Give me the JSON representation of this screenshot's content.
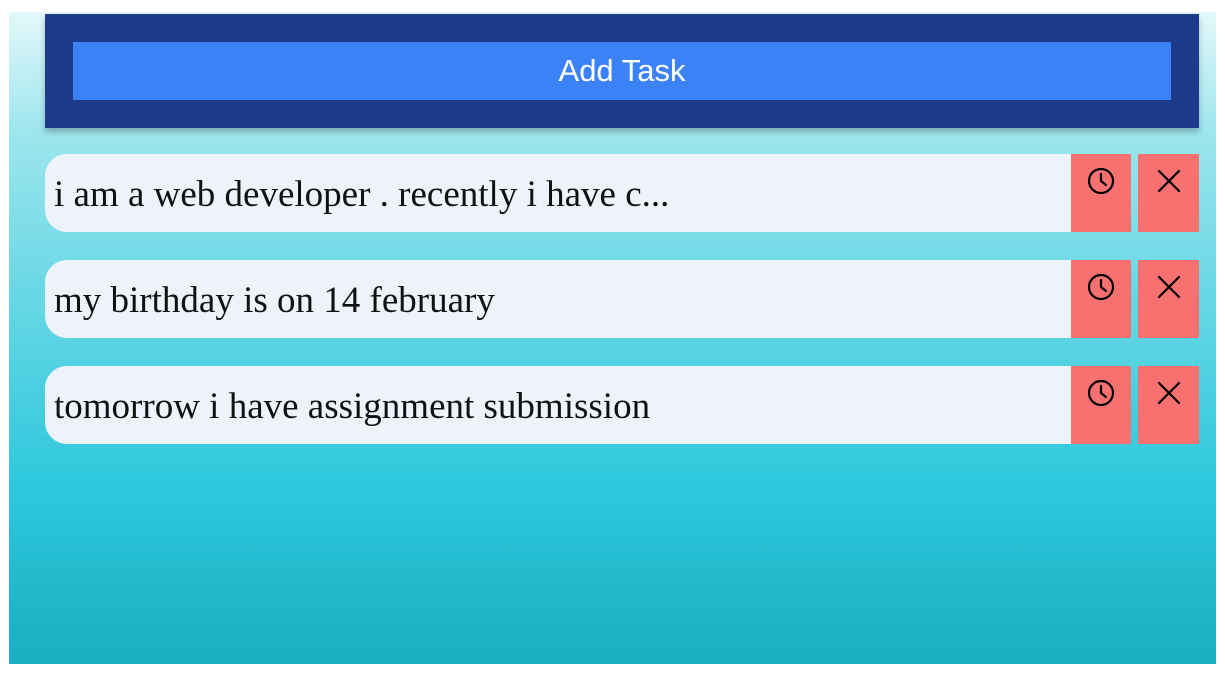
{
  "header": {
    "add_button_label": "Add Task"
  },
  "tasks": [
    {
      "text": "i am a web developer . recently i have c..."
    },
    {
      "text": "my birthday is on 14 february"
    },
    {
      "text": "tomorrow i have assignment submission"
    }
  ],
  "icons": {
    "reminder": "clock-icon",
    "delete": "close-icon"
  },
  "colors": {
    "header_bg": "#1e3a8a",
    "add_button_bg": "#3b82f6",
    "task_bg": "#eef3f9",
    "action_button_bg": "#f87171"
  }
}
